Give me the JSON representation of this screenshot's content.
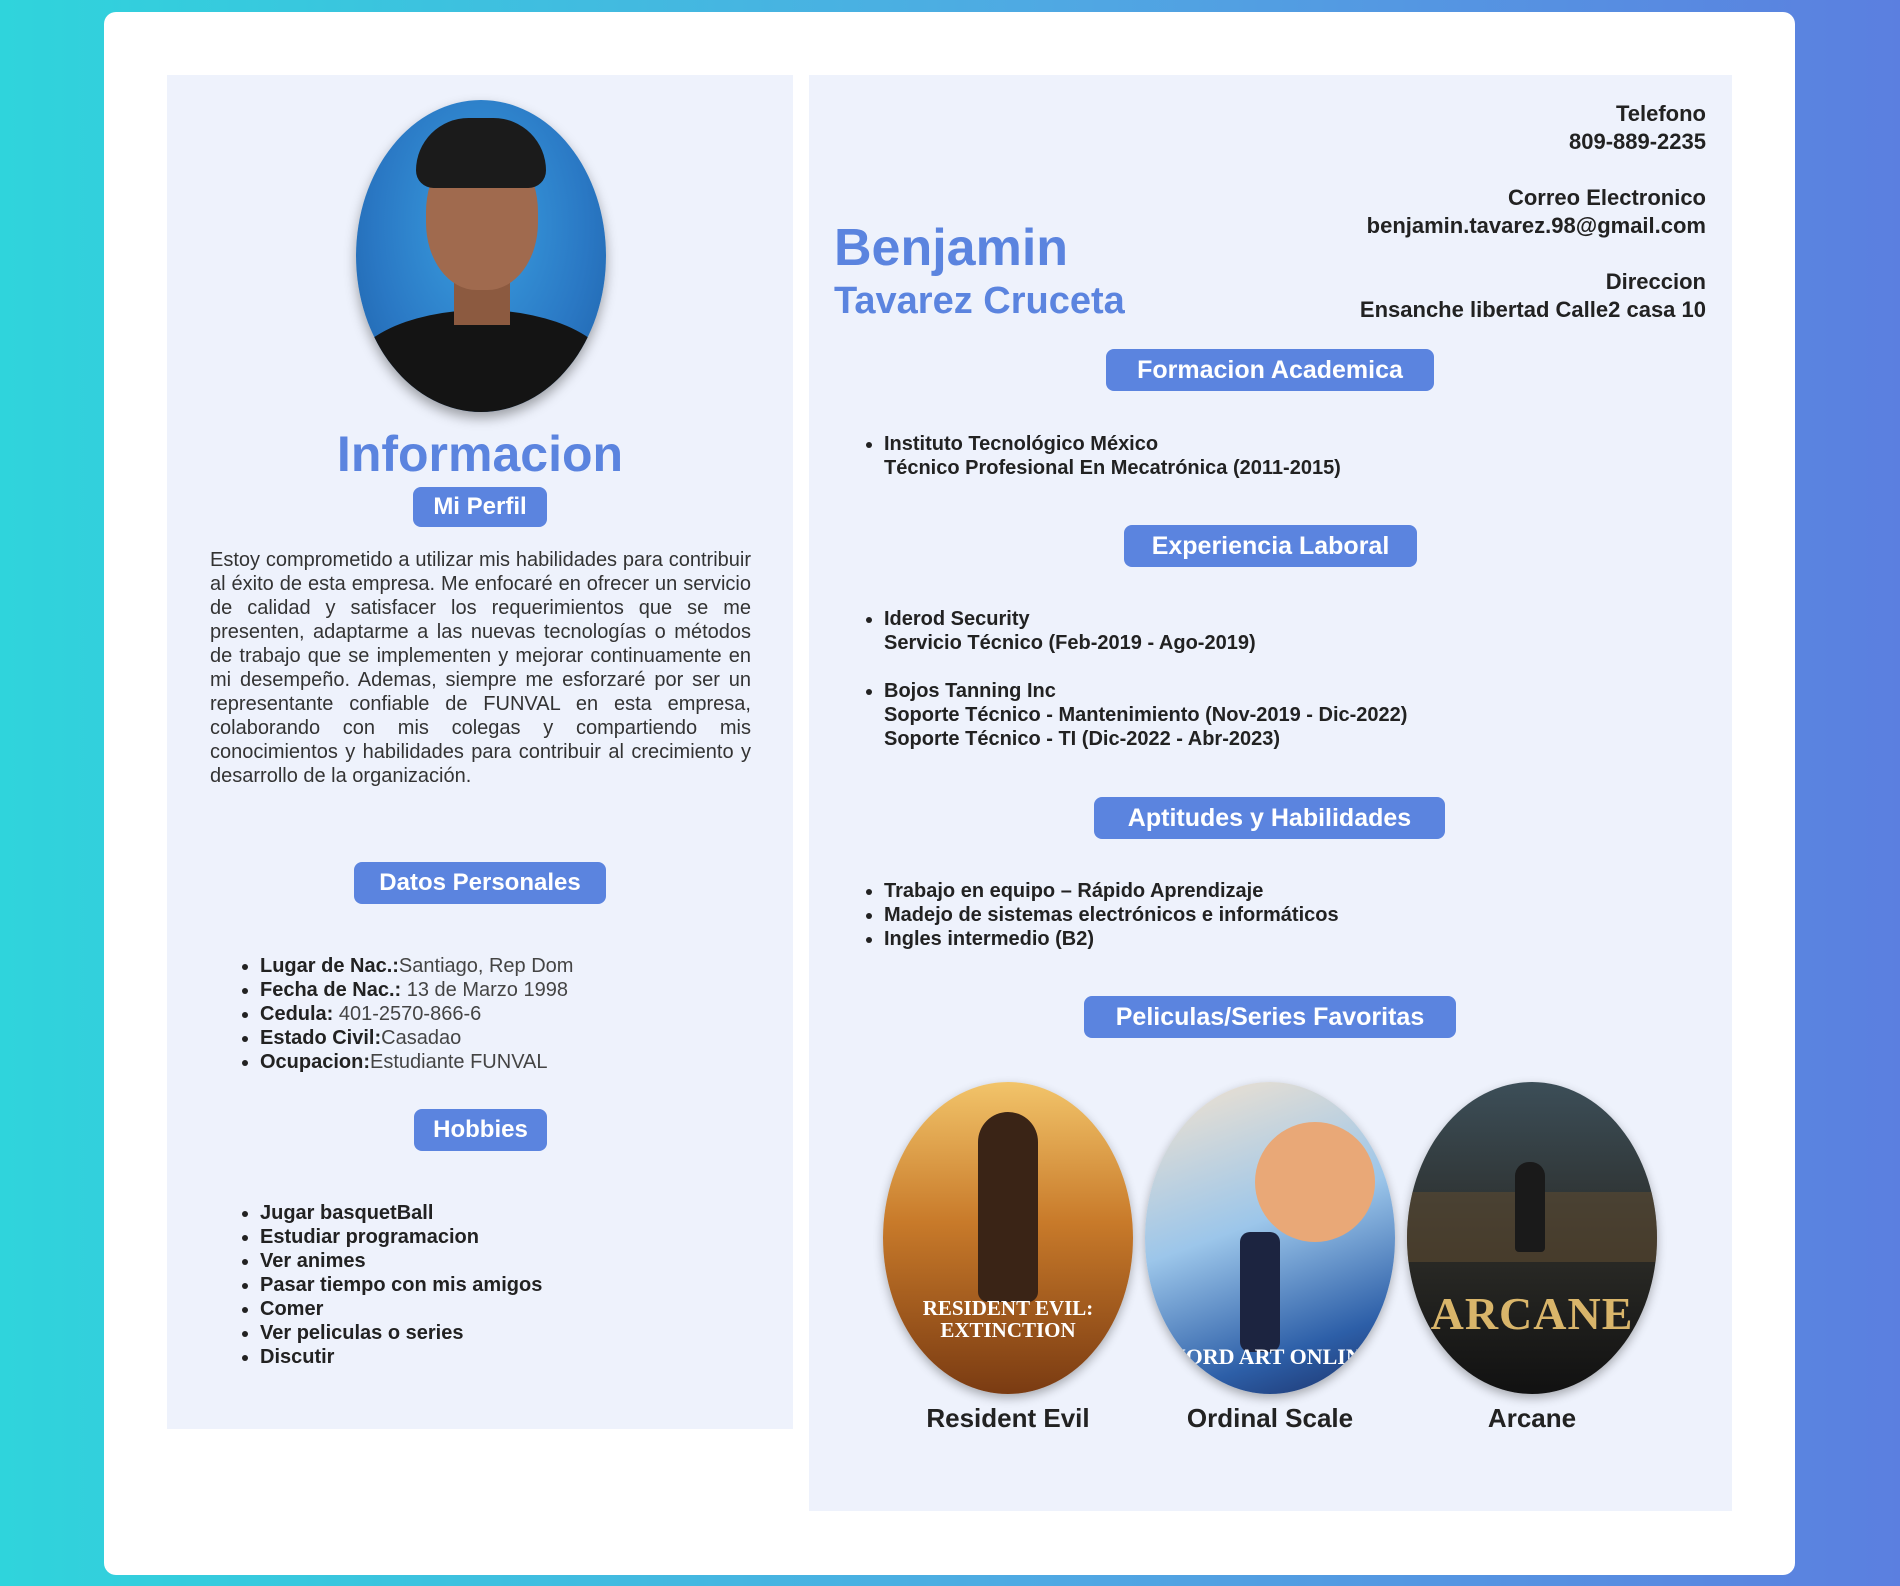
{
  "left": {
    "section_title": "Informacion",
    "profile_label": "Mi Perfil",
    "profile_text": "Estoy comprometido a utilizar mis habilidades para contribuir al éxito de esta empresa. Me enfocaré en ofrecer un servicio de calidad y satisfacer los requerimientos que se me presenten, adaptarme a las nuevas tecnologías o métodos de trabajo que se implementen y mejorar continuamente en mi desempeño. Ademas, siempre me esforzaré por ser un representante confiable de FUNVAL en esta empresa, colaborando con mis colegas y compartiendo mis conocimientos y habilidades para contribuir al crecimiento y desarrollo de la organización.",
    "personal_label": "Datos Personales",
    "personal": [
      {
        "k": "Lugar de Nac.:",
        "v": "Santiago, Rep Dom"
      },
      {
        "k": "Fecha de Nac.:",
        "v": " 13 de Marzo 1998"
      },
      {
        "k": "Cedula:",
        "v": " 401-2570-866-6"
      },
      {
        "k": "Estado Civil:",
        "v": "Casadao"
      },
      {
        "k": "Ocupacion:",
        "v": "Estudiante FUNVAL"
      }
    ],
    "hobbies_label": "Hobbies",
    "hobbies": [
      "Jugar basquetBall",
      "Estudiar programacion",
      "Ver animes",
      "Pasar tiempo con mis amigos",
      "Comer",
      "Ver peliculas o series",
      "Discutir"
    ]
  },
  "right": {
    "first_name": "Benjamin",
    "last_name": "Tavarez Cruceta",
    "phone_label": "Telefono",
    "phone": "809-889-2235",
    "email_label": "Correo Electronico",
    "email": "benjamin.tavarez.98@gmail.com",
    "address_label": "Direccion",
    "address": "Ensanche libertad Calle2 casa 10",
    "education_label": "Formacion Academica",
    "education": [
      {
        "line1": "Instituto Tecnológico México",
        "line2": "Técnico Profesional En Mecatrónica (2011-2015)"
      }
    ],
    "experience_label": "Experiencia Laboral",
    "experience": [
      {
        "line1": "Iderod Security",
        "line2": "Servicio Técnico (Feb-2019 - Ago-2019)",
        "line3": ""
      },
      {
        "line1": "Bojos Tanning Inc",
        "line2": "Soporte Técnico - Mantenimiento (Nov-2019 - Dic-2022)",
        "line3": "Soporte Técnico - TI (Dic-2022 - Abr-2023)"
      }
    ],
    "skills_label": "Aptitudes y Habilidades",
    "skills": [
      "Trabajo en equipo – Rápido Aprendizaje",
      "Madejo de sistemas electrónicos e informáticos",
      "Ingles intermedio (B2)"
    ],
    "movies_label": "Peliculas/Series Favoritas",
    "movies": [
      {
        "title": "Resident Evil",
        "poster_text": "RESIDENT EVIL: EXTINCTION"
      },
      {
        "title": "Ordinal Scale",
        "poster_text": "WORD ART ONLINE"
      },
      {
        "title": "Arcane",
        "poster_text": "ARCANE"
      }
    ]
  }
}
